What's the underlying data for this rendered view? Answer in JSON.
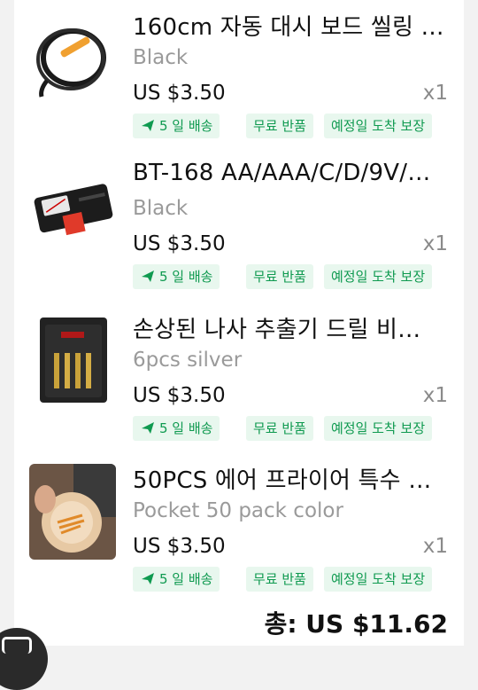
{
  "items": [
    {
      "title": "160cm 자동 대시 보드 씰링 …",
      "variant": "Black",
      "price": "US $3.50",
      "qty": "x1",
      "tags": [
        "5 일 배송",
        "무료 반품",
        "예정일 도착 보장"
      ],
      "image_icon": "rubber-seal-strip-icon"
    },
    {
      "title": "BT-168 AA/AAA/C/D/9V/…",
      "variant": "Black",
      "price": "US $3.50",
      "qty": "x1",
      "tags": [
        "5 일 배송",
        "무료 반품",
        "예정일 도착 보장"
      ],
      "image_icon": "battery-tester-icon"
    },
    {
      "title": "손상된 나사 추출기 드릴 비…",
      "variant": "6pcs silver",
      "price": "US $3.50",
      "qty": "x1",
      "tags": [
        "5 일 배송",
        "무료 반품",
        "예정일 도착 보장"
      ],
      "image_icon": "screw-extractor-set-icon"
    },
    {
      "title": "50PCS 에어 프라이어 특수 …",
      "variant": "Pocket 50 pack color",
      "price": "US $3.50",
      "qty": "x1",
      "tags": [
        "5 일 배송",
        "무료 반품",
        "예정일 도착 보장"
      ],
      "image_icon": "air-fryer-paper-icon"
    }
  ],
  "total": "총: US $11.62",
  "colors": {
    "tag_bg": "#e8f7ee",
    "tag_text": "#0f9a50",
    "price_text": "#111111",
    "muted_text": "#9a9a9a"
  }
}
